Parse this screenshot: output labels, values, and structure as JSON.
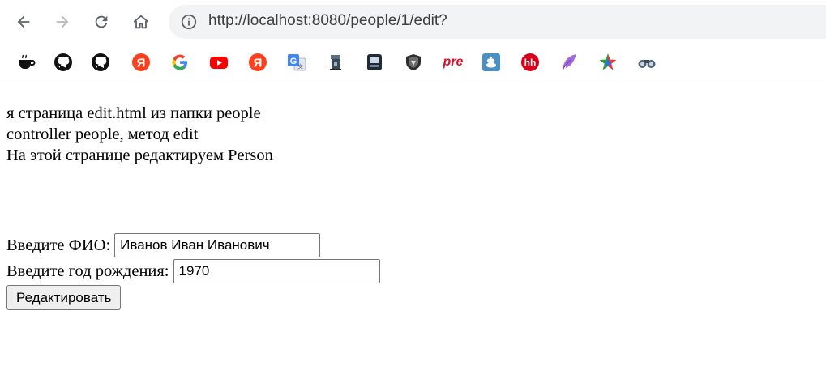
{
  "browser": {
    "url": "http://localhost:8080/people/1/edit?",
    "bookmarks": [
      {
        "icon": "coffee-cup-icon"
      },
      {
        "icon": "github-icon"
      },
      {
        "icon": "github-icon"
      },
      {
        "icon": "yandex-icon"
      },
      {
        "icon": "google-icon"
      },
      {
        "icon": "youtube-icon"
      },
      {
        "icon": "yandex-icon"
      },
      {
        "icon": "google-translate-icon"
      },
      {
        "icon": "tower-icon"
      },
      {
        "icon": "dark-app-icon"
      },
      {
        "icon": "shield-icon"
      },
      {
        "icon": "pre-icon",
        "text": "pre"
      },
      {
        "icon": "puzzle-icon"
      },
      {
        "icon": "headhunter-icon",
        "text": "hh"
      },
      {
        "icon": "feather-icon"
      },
      {
        "icon": "colorful-star-icon"
      },
      {
        "icon": "binoculars-icon"
      }
    ]
  },
  "page": {
    "lines": [
      "я страница edit.html из папки people",
      "controller people, метод edit",
      "На этой странице редактируем Person"
    ],
    "form": {
      "fio_label": "Введите ФИО:",
      "fio_value": "Иванов Иван Иванович",
      "year_label": "Введите год рождения:",
      "year_value": "1970",
      "submit_label": "Редактировать"
    }
  },
  "colors": {
    "omnibox": "#f1f3f4",
    "yandex": "#fc3f1d",
    "youtube": "#ff0000",
    "hh": "#d6001c"
  }
}
